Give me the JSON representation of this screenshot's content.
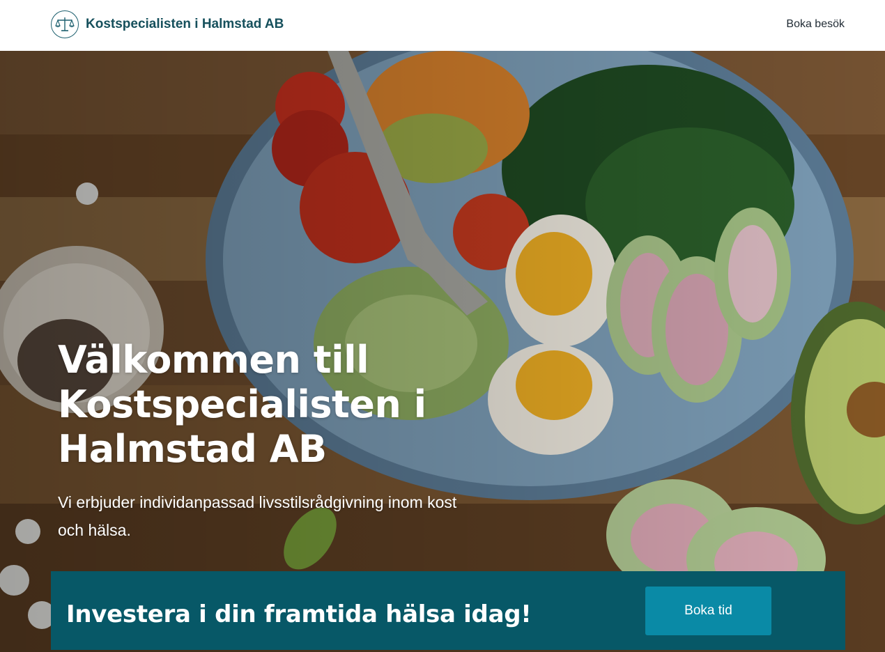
{
  "header": {
    "brand_name": "Kostspecialisten i Halmstad AB",
    "logo_icon": "scales-of-justice-icon",
    "nav_link": "Boka besök"
  },
  "hero": {
    "title": "Välkommen till Kostspecialisten i Halmstad AB",
    "subtitle": "Vi erbjuder individanpassad livsstilsrådgivning inom kost och hälsa.",
    "image": "photo of salad bowl with egg, tomatoes, greens, radish and avocado on wooden table"
  },
  "cta": {
    "text": "Investera i din framtida hälsa idag!",
    "button_label": "Boka tid"
  },
  "colors": {
    "brand": "#16505c",
    "cta_band": "#075867",
    "cta_button": "#0a8aa6"
  }
}
